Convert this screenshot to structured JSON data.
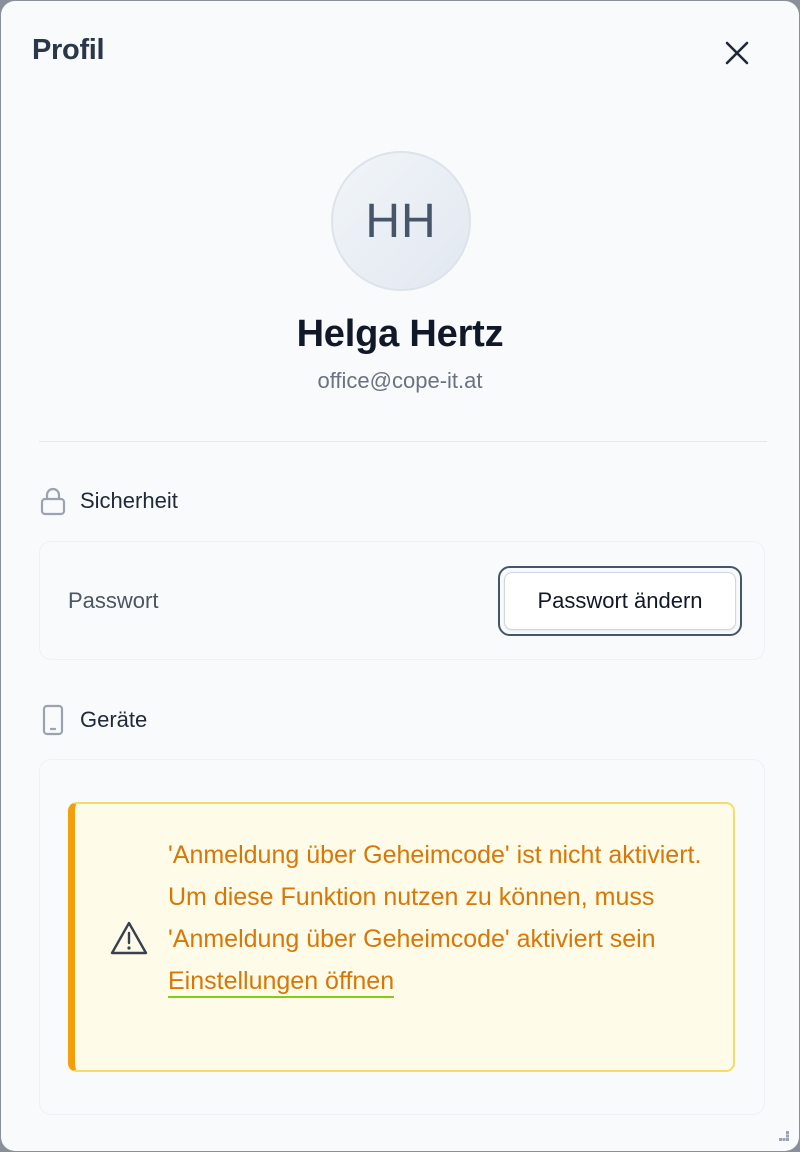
{
  "dialog": {
    "title": "Profil",
    "close_icon": "close-icon"
  },
  "profile": {
    "initials": "HH",
    "name": "Helga Hertz",
    "email": "office@cope-it.at"
  },
  "security": {
    "heading": "Sicherheit",
    "icon": "lock-icon",
    "password_label": "Passwort",
    "change_password_button": "Passwort ändern"
  },
  "devices": {
    "heading": "Geräte",
    "icon": "phone-icon",
    "alert": {
      "icon": "warning-icon",
      "message": "'Anmeldung über Geheimcode' ist nicht aktiviert. Um diese Funktion nutzen zu können, muss 'Anmeldung über Geheimcode' aktiviert sein",
      "link_label": "Einstellungen öffnen"
    }
  },
  "colors": {
    "accent": "#475569",
    "warning_text": "#d97706",
    "warning_border": "#f59e0b",
    "warning_bg": "#fefbe8",
    "link_underline": "#84cc16"
  }
}
